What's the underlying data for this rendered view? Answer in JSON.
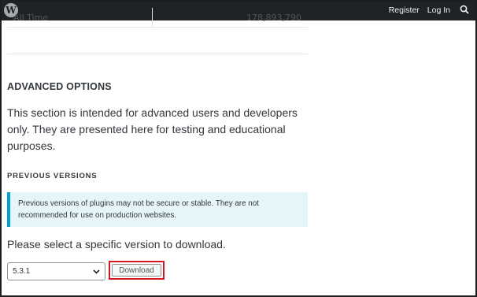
{
  "topbar": {
    "logo_glyph": "W",
    "register_label": "Register",
    "login_label": "Log In",
    "search_icon": "search-icon"
  },
  "stats_row": {
    "label": "All Time",
    "value": "178,893,790"
  },
  "advanced": {
    "heading": "ADVANCED OPTIONS",
    "description": "This section is intended for advanced users and developers only. They are presented here for testing and educational purposes."
  },
  "previous_versions": {
    "heading": "PREVIOUS VERSIONS",
    "notice": "Previous versions of plugins may not be secure or stable. They are not recommended for use on production websites.",
    "select_prompt": "Please select a specific version to download.",
    "selected_version": "5.3.1",
    "download_label": "Download"
  },
  "colors": {
    "topbar_bg": "#1d2327",
    "notice_bg": "#e5f5fa",
    "notice_border": "#00a0d2",
    "highlight": "#d2161e"
  }
}
